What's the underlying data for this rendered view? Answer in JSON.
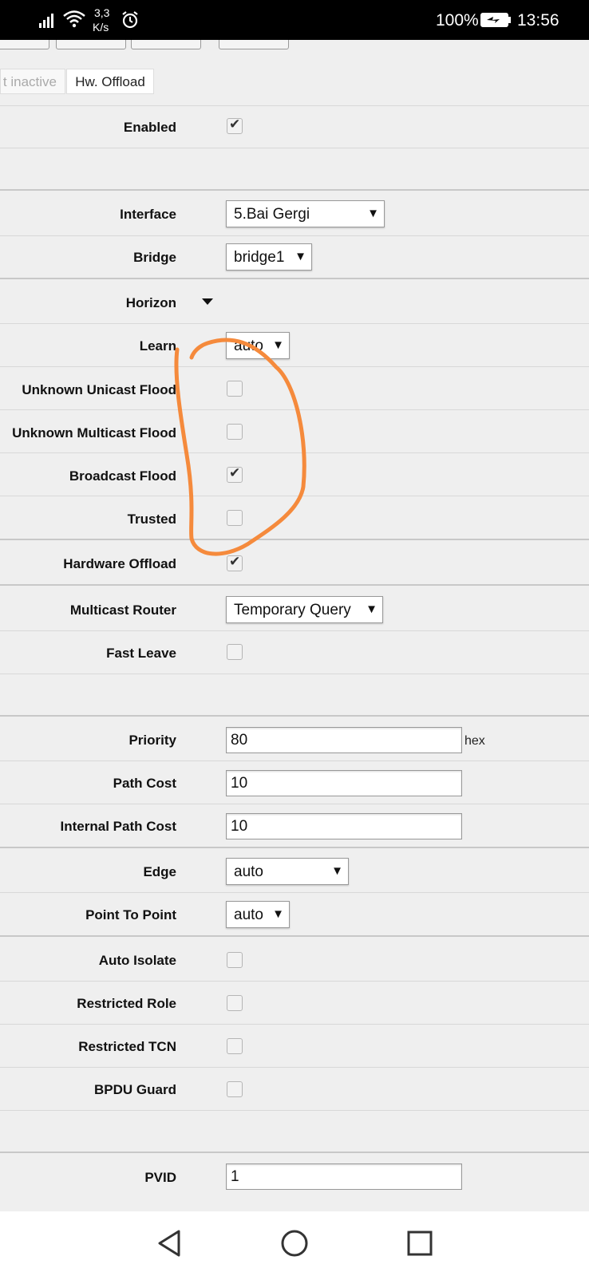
{
  "status_bar": {
    "net_speed_value": "3,3",
    "net_speed_unit": "K/s",
    "battery": "100%",
    "time": "13:56"
  },
  "tabs": [
    {
      "label": "t inactive",
      "active": false
    },
    {
      "label": "Hw. Offload",
      "active": true
    }
  ],
  "fields": {
    "enabled": {
      "label": "Enabled",
      "checked": true
    },
    "interface": {
      "label": "Interface",
      "value": "5.Bai Gergi"
    },
    "bridge": {
      "label": "Bridge",
      "value": "bridge1"
    },
    "horizon": {
      "label": "Horizon"
    },
    "learn": {
      "label": "Learn",
      "value": "auto"
    },
    "unknown_unicast_flood": {
      "label": "Unknown Unicast Flood",
      "checked": false
    },
    "unknown_multicast_flood": {
      "label": "Unknown Multicast Flood",
      "checked": false
    },
    "broadcast_flood": {
      "label": "Broadcast Flood",
      "checked": true
    },
    "trusted": {
      "label": "Trusted",
      "checked": false
    },
    "hardware_offload": {
      "label": "Hardware Offload",
      "checked": true
    },
    "multicast_router": {
      "label": "Multicast Router",
      "value": "Temporary Query"
    },
    "fast_leave": {
      "label": "Fast Leave",
      "checked": false
    },
    "priority": {
      "label": "Priority",
      "value": "80",
      "suffix": "hex"
    },
    "path_cost": {
      "label": "Path Cost",
      "value": "10"
    },
    "internal_path_cost": {
      "label": "Internal Path Cost",
      "value": "10"
    },
    "edge": {
      "label": "Edge",
      "value": "auto"
    },
    "point_to_point": {
      "label": "Point To Point",
      "value": "auto"
    },
    "auto_isolate": {
      "label": "Auto Isolate",
      "checked": false
    },
    "restricted_role": {
      "label": "Restricted Role",
      "checked": false
    },
    "restricted_tcn": {
      "label": "Restricted TCN",
      "checked": false
    },
    "bpdu_guard": {
      "label": "BPDU Guard",
      "checked": false
    },
    "pvid": {
      "label": "PVID",
      "value": "1"
    }
  },
  "icons": {
    "dropdown_arrow": "▼",
    "check": "✔"
  },
  "colors": {
    "annotation": "#f58a3c",
    "background": "#efefef"
  }
}
